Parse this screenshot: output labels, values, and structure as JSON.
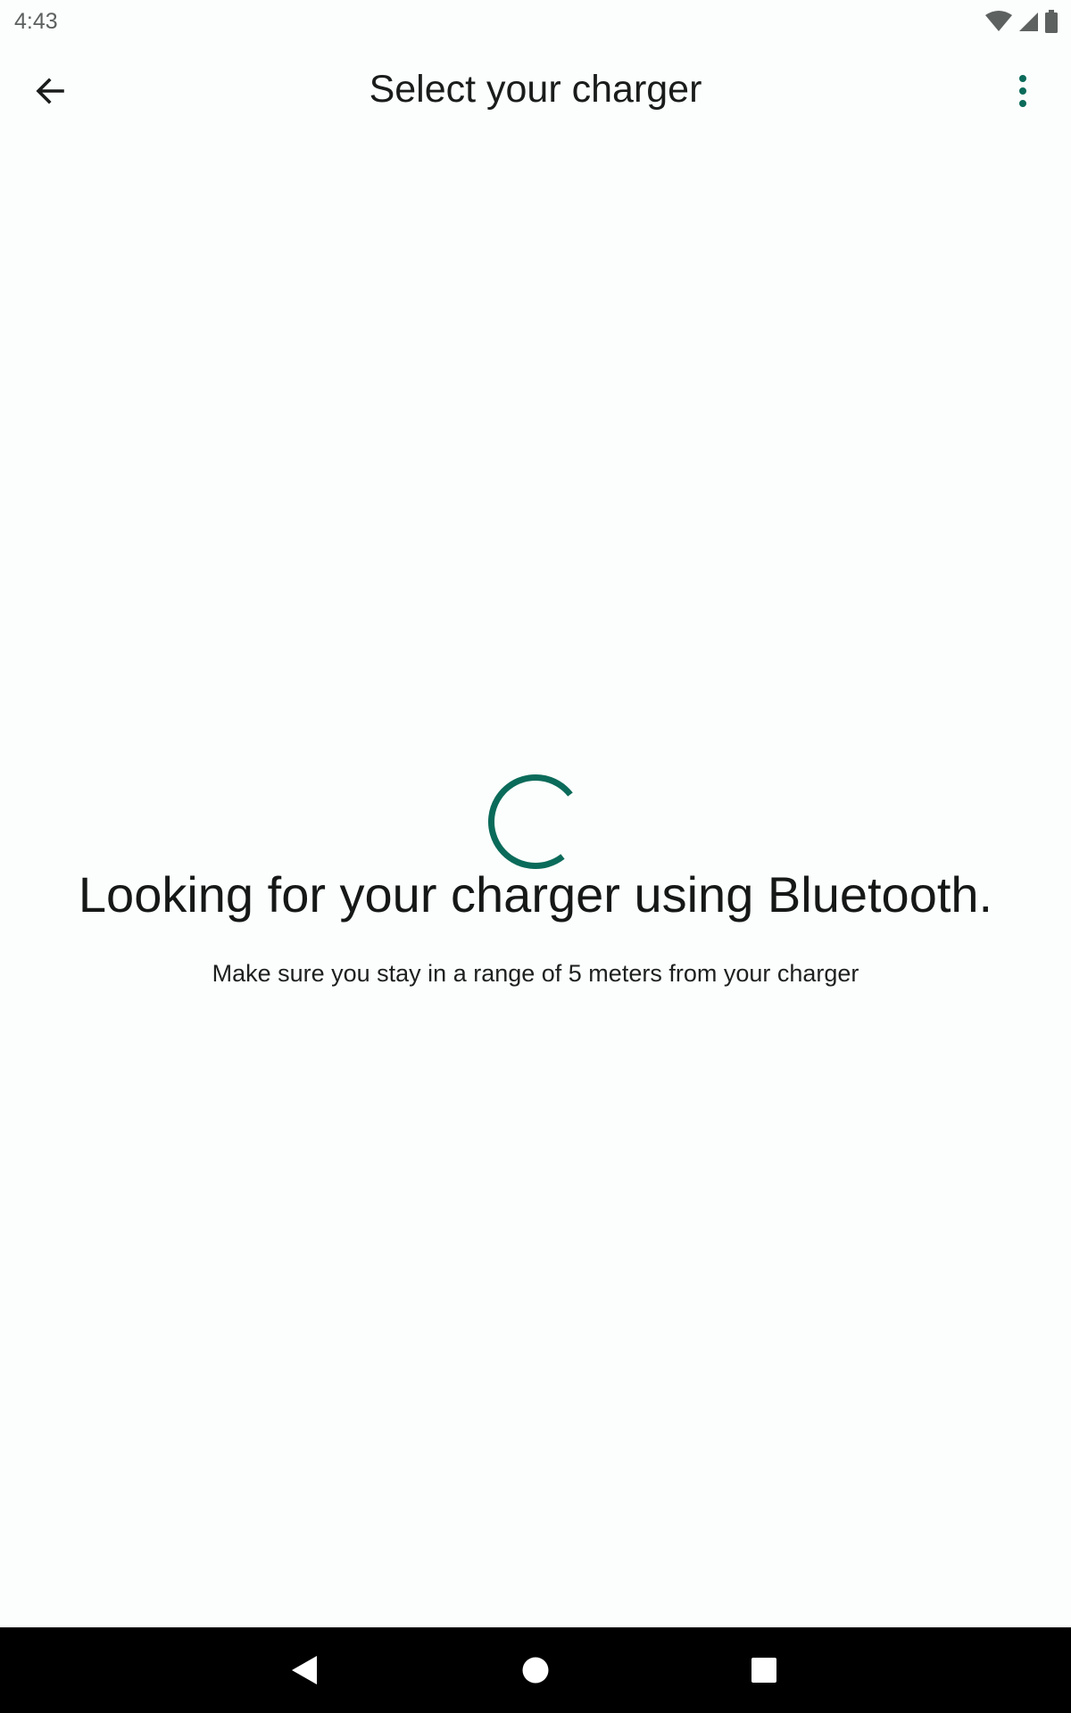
{
  "status_bar": {
    "time": "4:43",
    "icons": [
      "wifi-icon",
      "cell-signal-icon",
      "battery-icon"
    ]
  },
  "app_bar": {
    "title": "Select your charger",
    "back_icon": "arrow-left-icon",
    "menu_icon": "more-vertical-icon"
  },
  "content": {
    "headline": "Looking for your charger using Bluetooth.",
    "subtext": "Make sure you stay in a range of 5 meters from your charger"
  },
  "colors": {
    "accent": "#0b6b5a",
    "background": "#fbfefc",
    "nav_bar": "#000000"
  },
  "nav_bar": {
    "icons": [
      "nav-back-icon",
      "nav-home-icon",
      "nav-recents-icon"
    ]
  }
}
